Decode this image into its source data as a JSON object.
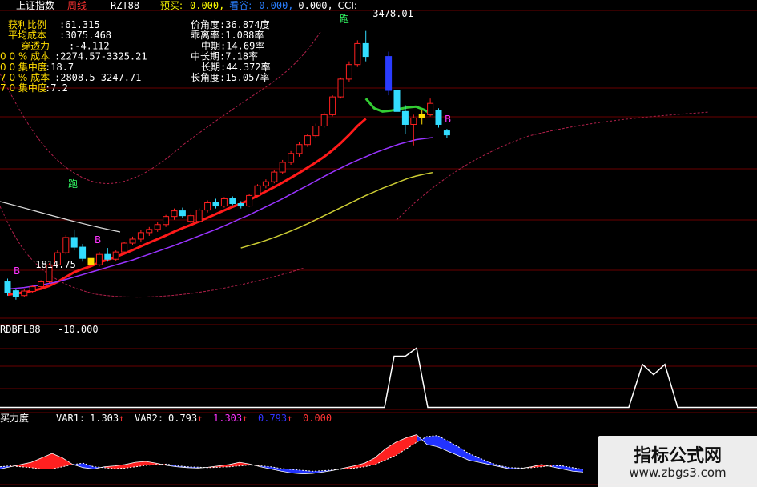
{
  "chart_data": [
    {
      "type": "candlestick",
      "panel": "main",
      "header": {
        "title": "上证指数",
        "period": "周线",
        "indicator": "RZT88",
        "items": [
          {
            "label": "预买:",
            "value": "0.000,",
            "color": "#ffff00"
          },
          {
            "label": "看谷:",
            "value": "0.000,",
            "color": "#2a7fff"
          },
          {
            "label": "",
            "value": "0.000,",
            "color": "#ffffff"
          },
          {
            "label": "CCI:",
            "value": "",
            "color": "#ffffff"
          }
        ]
      },
      "stats_left": [
        {
          "label": "获利比例",
          "value": ":61.315"
        },
        {
          "label": "平均成本",
          "value": ":3075.468"
        },
        {
          "label": "穿透力",
          "value": ":-4.112"
        },
        {
          "label": "0 0 % 成本",
          "value": ":2274.57-3325.21"
        },
        {
          "label": "0 0 集中度",
          "value": ":18.7"
        },
        {
          "label": "7 0 % 成本",
          "value": ":2808.5-3247.71"
        },
        {
          "label": "7 0 集中度",
          "value": ":7.2"
        }
      ],
      "stats_right": [
        {
          "label": "价角度",
          "value": ":36.874度"
        },
        {
          "label": "乖离率",
          "value": ":1.088率"
        },
        {
          "label": "中期",
          "value": ":14.69率"
        },
        {
          "label": "中长期",
          "value": ":7.18率"
        },
        {
          "label": "长期",
          "value": ":44.372率"
        },
        {
          "label": "长角度",
          "value": ":15.057率"
        }
      ],
      "annotations": [
        {
          "text": "3478.01",
          "kind": "high"
        },
        {
          "text": "1814.75",
          "kind": "low"
        },
        {
          "text": "B",
          "kind": "buy"
        },
        {
          "text": "B",
          "kind": "buy"
        },
        {
          "text": "B",
          "kind": "buy"
        },
        {
          "text": "跑",
          "kind": "sell"
        },
        {
          "text": "跑",
          "kind": "sell"
        }
      ],
      "y_range": [
        1700,
        3600
      ],
      "candles": [
        {
          "o": 1925,
          "h": 1945,
          "l": 1840,
          "c": 1860,
          "color": "cyan"
        },
        {
          "o": 1870,
          "h": 1880,
          "l": 1815,
          "c": 1835,
          "color": "cyan"
        },
        {
          "o": 1840,
          "h": 1880,
          "l": 1830,
          "c": 1868,
          "color": "red"
        },
        {
          "o": 1866,
          "h": 1905,
          "l": 1855,
          "c": 1895,
          "color": "red"
        },
        {
          "o": 1895,
          "h": 1935,
          "l": 1885,
          "c": 1925,
          "color": "red"
        },
        {
          "o": 1925,
          "h": 2040,
          "l": 1918,
          "c": 2030,
          "color": "red"
        },
        {
          "o": 2030,
          "h": 2120,
          "l": 2020,
          "c": 2105,
          "color": "red"
        },
        {
          "o": 2105,
          "h": 2215,
          "l": 2095,
          "c": 2200,
          "color": "red"
        },
        {
          "o": 2200,
          "h": 2250,
          "l": 2120,
          "c": 2140,
          "color": "cyan"
        },
        {
          "o": 2140,
          "h": 2160,
          "l": 2050,
          "c": 2070,
          "color": "cyan"
        },
        {
          "o": 2070,
          "h": 2100,
          "l": 2015,
          "c": 2030,
          "color": "yellow"
        },
        {
          "o": 2030,
          "h": 2110,
          "l": 2020,
          "c": 2095,
          "color": "red"
        },
        {
          "o": 2095,
          "h": 2135,
          "l": 2050,
          "c": 2065,
          "color": "cyan"
        },
        {
          "o": 2065,
          "h": 2120,
          "l": 2055,
          "c": 2110,
          "color": "red"
        },
        {
          "o": 2110,
          "h": 2175,
          "l": 2100,
          "c": 2165,
          "color": "red"
        },
        {
          "o": 2165,
          "h": 2205,
          "l": 2150,
          "c": 2190,
          "color": "red"
        },
        {
          "o": 2190,
          "h": 2245,
          "l": 2170,
          "c": 2230,
          "color": "red"
        },
        {
          "o": 2230,
          "h": 2265,
          "l": 2210,
          "c": 2250,
          "color": "red"
        },
        {
          "o": 2250,
          "h": 2295,
          "l": 2235,
          "c": 2280,
          "color": "red"
        },
        {
          "o": 2280,
          "h": 2340,
          "l": 2265,
          "c": 2330,
          "color": "red"
        },
        {
          "o": 2330,
          "h": 2380,
          "l": 2310,
          "c": 2365,
          "color": "red"
        },
        {
          "o": 2365,
          "h": 2385,
          "l": 2320,
          "c": 2335,
          "color": "cyan"
        },
        {
          "o": 2335,
          "h": 2350,
          "l": 2280,
          "c": 2300,
          "color": "red"
        },
        {
          "o": 2300,
          "h": 2380,
          "l": 2290,
          "c": 2370,
          "color": "red"
        },
        {
          "o": 2370,
          "h": 2430,
          "l": 2355,
          "c": 2415,
          "color": "red"
        },
        {
          "o": 2415,
          "h": 2440,
          "l": 2380,
          "c": 2395,
          "color": "cyan"
        },
        {
          "o": 2395,
          "h": 2450,
          "l": 2385,
          "c": 2440,
          "color": "red"
        },
        {
          "o": 2440,
          "h": 2455,
          "l": 2400,
          "c": 2410,
          "color": "cyan"
        },
        {
          "o": 2410,
          "h": 2425,
          "l": 2380,
          "c": 2395,
          "color": "cyan"
        },
        {
          "o": 2395,
          "h": 2470,
          "l": 2390,
          "c": 2460,
          "color": "red"
        },
        {
          "o": 2460,
          "h": 2530,
          "l": 2450,
          "c": 2520,
          "color": "red"
        },
        {
          "o": 2520,
          "h": 2560,
          "l": 2505,
          "c": 2545,
          "color": "red"
        },
        {
          "o": 2545,
          "h": 2620,
          "l": 2535,
          "c": 2605,
          "color": "red"
        },
        {
          "o": 2605,
          "h": 2680,
          "l": 2595,
          "c": 2665,
          "color": "red"
        },
        {
          "o": 2665,
          "h": 2735,
          "l": 2650,
          "c": 2720,
          "color": "red"
        },
        {
          "o": 2720,
          "h": 2790,
          "l": 2700,
          "c": 2775,
          "color": "red"
        },
        {
          "o": 2775,
          "h": 2840,
          "l": 2760,
          "c": 2830,
          "color": "red"
        },
        {
          "o": 2830,
          "h": 2905,
          "l": 2815,
          "c": 2890,
          "color": "red"
        },
        {
          "o": 2890,
          "h": 2975,
          "l": 2880,
          "c": 2960,
          "color": "red"
        },
        {
          "o": 2960,
          "h": 3080,
          "l": 2950,
          "c": 3070,
          "color": "red"
        },
        {
          "o": 3070,
          "h": 3190,
          "l": 3060,
          "c": 3180,
          "color": "red"
        },
        {
          "o": 3180,
          "h": 3290,
          "l": 3165,
          "c": 3270,
          "color": "red"
        },
        {
          "o": 3270,
          "h": 3420,
          "l": 3255,
          "c": 3400,
          "color": "red"
        },
        {
          "o": 3400,
          "h": 3478,
          "l": 3290,
          "c": 3320,
          "color": "cyan"
        },
        {
          "o": 3320,
          "h": 3350,
          "l": 3080,
          "c": 3110,
          "color": "blue"
        },
        {
          "o": 3110,
          "h": 3160,
          "l": 2820,
          "c": 2980,
          "color": "cyan"
        },
        {
          "o": 2980,
          "h": 3020,
          "l": 2840,
          "c": 2900,
          "color": "cyan"
        },
        {
          "o": 2900,
          "h": 2960,
          "l": 2770,
          "c": 2940,
          "color": "red"
        },
        {
          "o": 2940,
          "h": 2990,
          "l": 2900,
          "c": 2960,
          "color": "yellow"
        },
        {
          "o": 2960,
          "h": 3060,
          "l": 2950,
          "c": 3030,
          "color": "red"
        },
        {
          "o": 2985,
          "h": 3000,
          "l": 2880,
          "c": 2900,
          "color": "cyan"
        },
        {
          "o": 2860,
          "h": 2872,
          "l": 2815,
          "c": 2835,
          "color": "cyan"
        }
      ],
      "lines": [
        {
          "name": "",
          "color": "#ff1a1a",
          "values": [
            1845,
            1852,
            1860,
            1870,
            1882,
            1900,
            1925,
            1955,
            1985,
            2005,
            2022,
            2045,
            2062,
            2080,
            2100,
            2122,
            2145,
            2168,
            2190,
            2212,
            2236,
            2258,
            2278,
            2300,
            2322,
            2345,
            2368,
            2390,
            2410,
            2432,
            2458,
            2485,
            2512,
            2540,
            2570,
            2600,
            2632,
            2665,
            2700,
            2740,
            2785,
            2835,
            2890,
            2935
          ],
          "green_values": [
            3060,
            3000,
            2980,
            2985,
            2995,
            3005,
            3010,
            2990,
            2960
          ]
        },
        {
          "name": "",
          "color": "#9933ff",
          "values": [
            1880,
            1885,
            1890,
            1898,
            1905,
            1915,
            1925,
            1940,
            1955,
            1970,
            1985,
            2000,
            2015,
            2030,
            2045,
            2060,
            2078,
            2096,
            2114,
            2132,
            2150,
            2170,
            2190,
            2210,
            2230,
            2250,
            2272,
            2295,
            2318,
            2340,
            2365,
            2390,
            2415,
            2440,
            2468,
            2495,
            2522,
            2550,
            2578,
            2605,
            2630,
            2655,
            2678,
            2700,
            2722,
            2742,
            2760,
            2778,
            2792,
            2805,
            2812,
            2818
          ]
        },
        {
          "name": "",
          "color": "#cccc33",
          "values": [
            null,
            null,
            null,
            null,
            null,
            null,
            null,
            null,
            null,
            null,
            null,
            null,
            null,
            null,
            null,
            null,
            null,
            null,
            null,
            null,
            null,
            null,
            null,
            null,
            null,
            null,
            null,
            null,
            2135,
            2150,
            2165,
            2182,
            2200,
            2220,
            2240,
            2262,
            2285,
            2310,
            2335,
            2360,
            2385,
            2410,
            2435,
            2460,
            2482,
            2505,
            2525,
            2545,
            2565,
            2580,
            2592,
            2602
          ]
        }
      ]
    },
    {
      "type": "line",
      "panel": "rdbfl",
      "title": "RDBFL88",
      "value_label": "-10.000",
      "y_range": [
        -12,
        60
      ],
      "values": [
        -10,
        -10,
        -10,
        -10,
        -10,
        -10,
        -10,
        -10,
        -10,
        -10,
        -10,
        -10,
        -10,
        -10,
        -10,
        -10,
        -10,
        -10,
        -10,
        -10,
        -10,
        -10,
        -10,
        -10,
        -10,
        -10,
        -10,
        -10,
        -10,
        -10,
        -10,
        -10,
        -10,
        -10,
        -10,
        -10,
        -10,
        -10,
        -10,
        -10,
        -10,
        -10,
        -10,
        -10,
        -10,
        -10,
        -10,
        -10,
        -10,
        -10,
        -10,
        -10,
        -10,
        -10,
        -10,
        -10,
        -10,
        -10,
        -10,
        -10,
        -10,
        -10,
        -10,
        -10,
        -10,
        -10,
        -10,
        -10,
        -10,
        -10,
        -10,
        -10,
        -10,
        -10,
        -10,
        -10,
        -10,
        -10,
        -10,
        -10,
        -10,
        -10,
        -10,
        -10,
        -10,
        -10,
        -10,
        -10,
        -10,
        -10,
        -10,
        -10,
        -10,
        -10,
        -10,
        -10,
        -10,
        -10,
        -10,
        -10
      ],
      "spikes": [
        {
          "points": [
            [
              -10
            ],
            [
              40
            ],
            [
              40
            ],
            [
              48
            ],
            [
              -10
            ]
          ],
          "kind": "first"
        },
        {
          "points": [
            [
              -10
            ],
            [
              32
            ],
            [
              22
            ],
            [
              32
            ],
            [
              -10
            ]
          ],
          "kind": "second"
        }
      ]
    },
    {
      "type": "area",
      "panel": "buy-power",
      "title": "买力度",
      "legend": [
        {
          "name": "VAR1:",
          "value": "1.303",
          "arrow": "↑",
          "color": "#ffffff"
        },
        {
          "name": "VAR2:",
          "value": "0.793",
          "arrow": "↑",
          "color": "#ffffff"
        },
        {
          "name": "",
          "value": "1.303",
          "arrow": "↑",
          "color": "#ff33ff"
        },
        {
          "name": "",
          "value": "0.793",
          "arrow": "↑",
          "color": "#3333ff"
        },
        {
          "name": "",
          "value": "0.000",
          "arrow": "",
          "color": "#ff3333"
        }
      ],
      "var1": [
        0.95,
        1.0,
        1.05,
        1.1,
        1.2,
        1.3,
        1.2,
        1.05,
        0.98,
        0.95,
        1.0,
        1.02,
        1.05,
        1.1,
        1.12,
        1.08,
        1.03,
        1.0,
        0.98,
        0.97,
        0.99,
        1.02,
        1.05,
        1.1,
        1.06,
        1.0,
        0.95,
        0.9,
        0.86,
        0.84,
        0.85,
        0.88,
        0.92,
        0.97,
        1.02,
        1.08,
        1.2,
        1.4,
        1.55,
        1.65,
        1.72,
        1.5,
        1.45,
        1.35,
        1.25,
        1.15,
        1.1,
        1.05,
        1.0,
        0.95,
        0.96,
        1.0,
        1.05,
        1.0,
        0.95,
        0.9,
        0.88
      ],
      "var2": [
        1.0,
        1.02,
        1.0,
        0.98,
        0.95,
        0.95,
        1.0,
        1.05,
        1.08,
        1.0,
        0.98,
        0.96,
        0.97,
        1.0,
        1.03,
        1.05,
        1.06,
        1.02,
        1.0,
        0.99,
        0.98,
        0.99,
        1.0,
        1.02,
        1.04,
        1.02,
        1.0,
        0.96,
        0.94,
        0.92,
        0.9,
        0.91,
        0.93,
        0.95,
        0.97,
        1.0,
        1.05,
        1.15,
        1.25,
        1.4,
        1.55,
        1.68,
        1.7,
        1.58,
        1.45,
        1.3,
        1.2,
        1.1,
        1.02,
        0.98,
        0.97,
        0.98,
        1.0,
        1.03,
        1.02,
        0.98,
        0.94
      ],
      "y_range": [
        0.6,
        2.0
      ]
    }
  ],
  "watermark": {
    "cn": "指标公式网",
    "url": "www.zbgs3.com"
  }
}
